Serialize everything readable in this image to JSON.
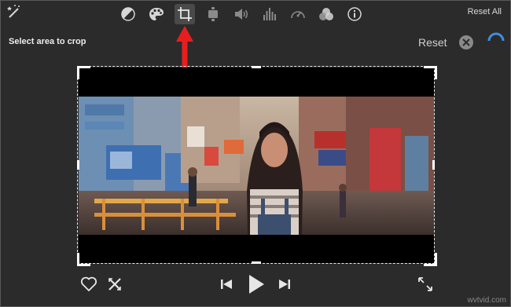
{
  "toolbar": {
    "tools": [
      {
        "name": "magic-wand-icon"
      },
      {
        "name": "color-balance-icon"
      },
      {
        "name": "color-correction-icon"
      },
      {
        "name": "crop-icon",
        "active": true
      },
      {
        "name": "stabilization-icon"
      },
      {
        "name": "volume-icon"
      },
      {
        "name": "noise-reduction-icon"
      },
      {
        "name": "speed-icon"
      },
      {
        "name": "clip-filter-icon"
      },
      {
        "name": "info-icon"
      }
    ],
    "reset_all_label": "Reset All"
  },
  "crop_panel": {
    "instruction": "Select area to crop",
    "reset_label": "Reset"
  },
  "viewer": {
    "content": "video-frame"
  },
  "playback": {
    "favorite": "heart-icon",
    "reject": "reject-icon",
    "previous": "skip-back-icon",
    "play": "play-icon",
    "next": "skip-forward-icon",
    "fullscreen": "fullscreen-icon"
  },
  "watermark": "wvtvid.com",
  "colors": {
    "background": "#2b2b2b",
    "annotation_arrow": "#e81e1e",
    "icon": "#d6d6d6"
  }
}
